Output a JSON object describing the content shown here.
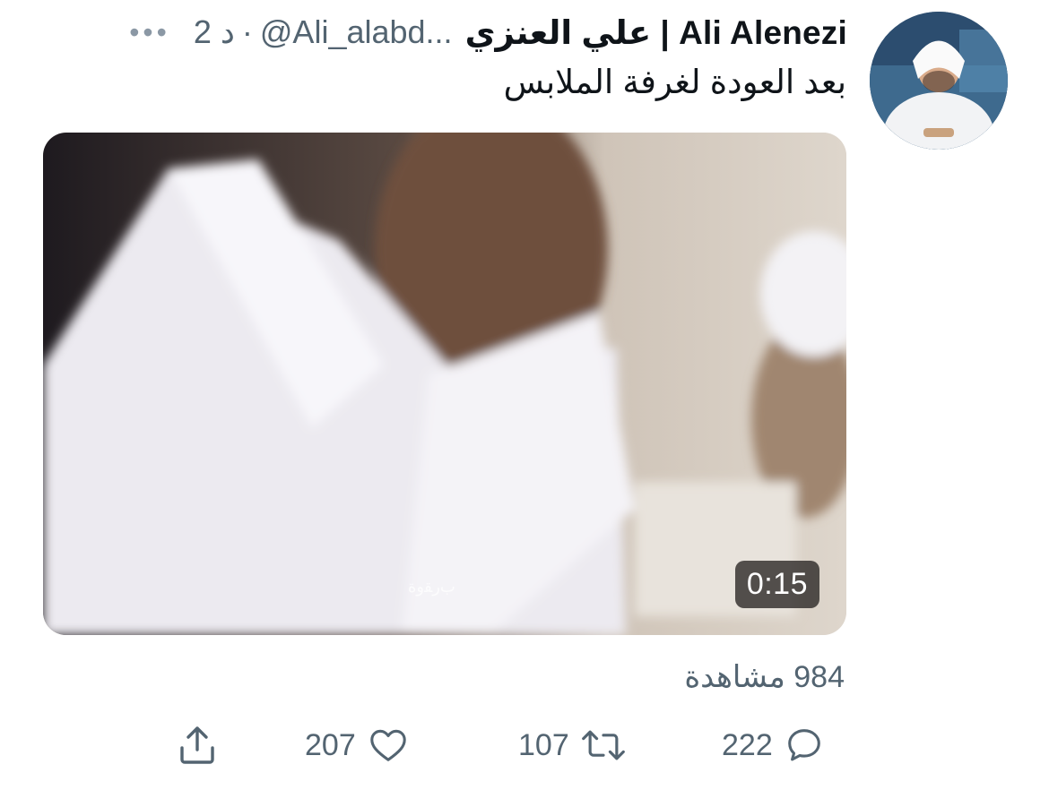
{
  "tweet": {
    "display_name": "علي العنزي | Ali Alenezi",
    "handle": "@Ali_alabd...",
    "separator": "·",
    "time": "2 د",
    "more_icon": "more-dots-icon",
    "more_glyph": "•••",
    "text": "بعد العودة لغرفة الملابس"
  },
  "media": {
    "type": "video",
    "duration": "0:15",
    "watermark": "ﺏﺭﻘﻭﺓ"
  },
  "views": {
    "label": "984 مشاهدة"
  },
  "actions": {
    "reply": {
      "icon": "reply-icon",
      "count": "222"
    },
    "retweet": {
      "icon": "retweet-icon",
      "count": "107"
    },
    "like": {
      "icon": "heart-icon",
      "count": "207"
    },
    "share": {
      "icon": "share-icon"
    }
  },
  "colors": {
    "text_primary": "#0f1419",
    "text_secondary": "#536471",
    "background": "#ffffff",
    "duration_badge": "#282422"
  }
}
